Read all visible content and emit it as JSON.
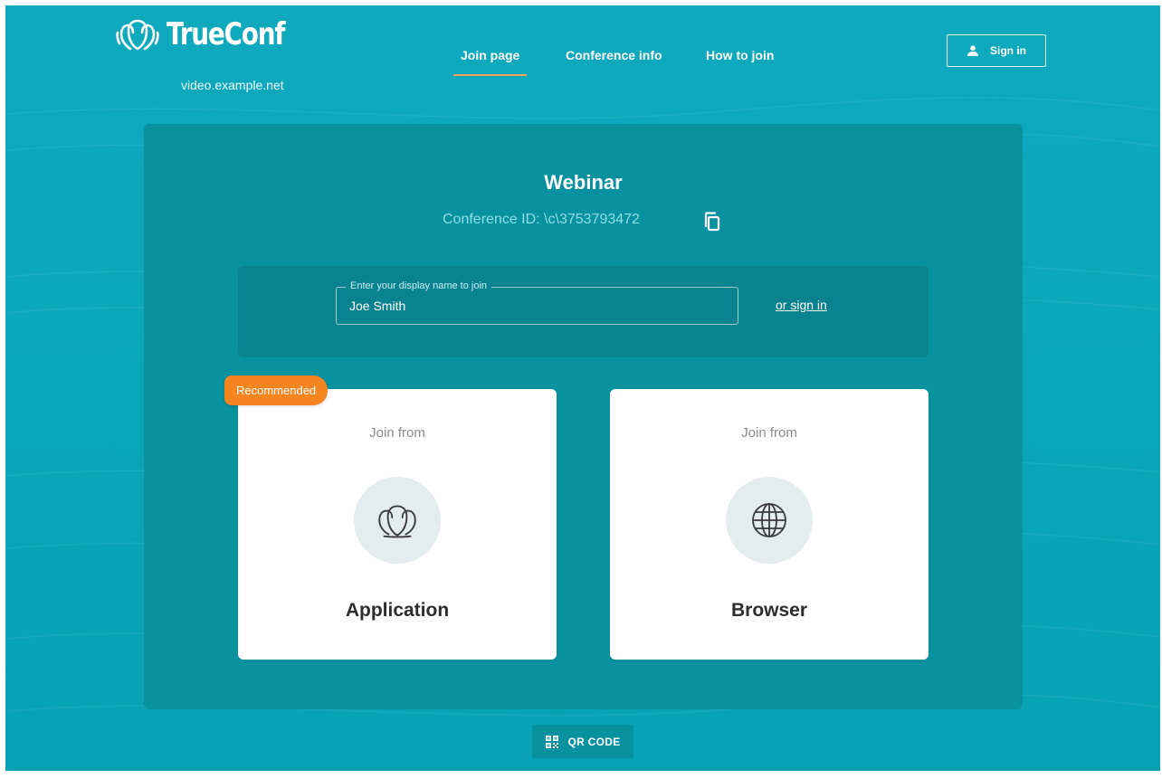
{
  "brand": {
    "name": "TrueConf",
    "server": "video.example.net",
    "logo_icon": "users-group-icon"
  },
  "nav": {
    "items": [
      {
        "label": "Join page",
        "active": true
      },
      {
        "label": "Conference info",
        "active": false
      },
      {
        "label": "How to join",
        "active": false
      }
    ]
  },
  "header": {
    "sign_in_label": "Sign in",
    "sign_in_icon": "user-icon"
  },
  "conference": {
    "title": "Webinar",
    "id_label": "Conference ID: \\c\\3753793472",
    "copy_icon": "copy-icon"
  },
  "join_form": {
    "legend": "Enter your display name to join",
    "value": "Joe Smith",
    "or_sign_in": "or sign in"
  },
  "options": {
    "application": {
      "pre_label": "Join from",
      "label": "Application",
      "badge": "Recommended",
      "icon": "users-group-icon"
    },
    "browser": {
      "pre_label": "Join from",
      "label": "Browser",
      "icon": "globe-icon"
    }
  },
  "footer": {
    "qr_label": "QR CODE",
    "qr_icon": "qr-code-icon"
  },
  "colors": {
    "background": "#0aa7b8",
    "panel": "#08919f",
    "name_box": "#08838f",
    "accent_underline": "#f3a25a",
    "badge": "#f6851f",
    "card": "#ffffff",
    "icon_circle": "#e5eced"
  }
}
